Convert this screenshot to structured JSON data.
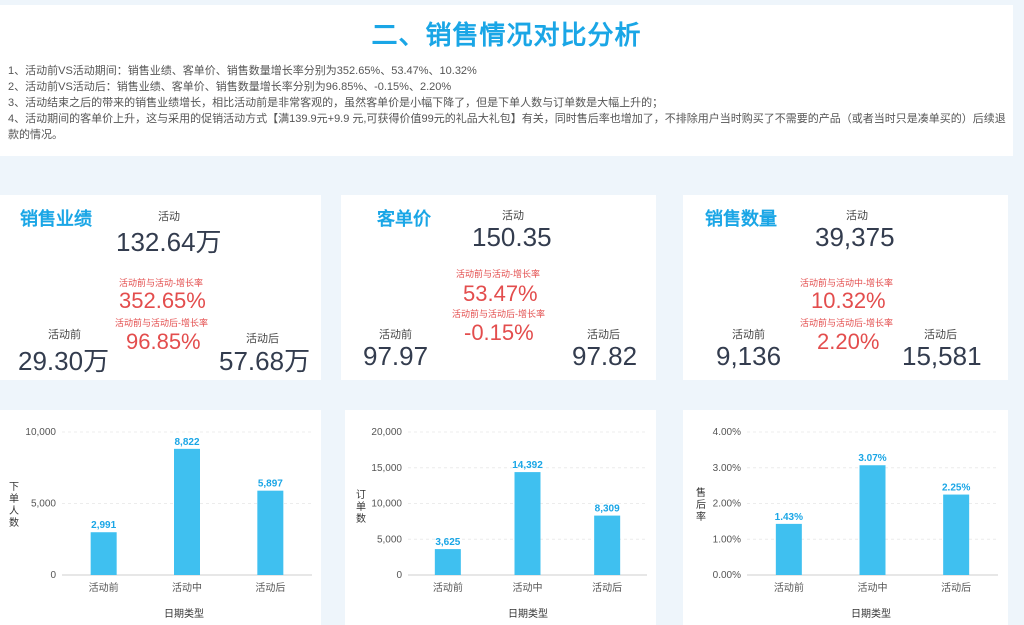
{
  "header": {
    "title": "二、销售情况对比分析",
    "notes": [
      "1、活动前VS活动期间：销售业绩、客单价、销售数量增长率分别为352.65%、53.47%、10.32%",
      "2、活动前VS活动后：销售业绩、客单价、销售数量增长率分别为96.85%、-0.15%、2.20%",
      "3、活动结束之后的带来的销售业绩增长，相比活动前是非常客观的，虽然客单价是小幅下降了，但是下单人数与订单数是大幅上升的；",
      "4、活动期间的客单价上升，这与采用的促销活动方式【满139.9元+9.9 元,可获得价值99元的礼品大礼包】有关，同时售后率也增加了，不排除用户当时购买了不需要的产品（或者当时只是凑单买的）后续退款的情况。"
    ]
  },
  "kpis": [
    {
      "title": "销售业绩",
      "during_label": "活动",
      "during_value": "132.64万",
      "rate1_label": "活动前与活动-增长率",
      "rate1_value": "352.65%",
      "rate2_label": "活动前与活动后-增长率",
      "rate2_value": "96.85%",
      "before_label": "活动前",
      "before_value": "29.30万",
      "after_label": "活动后",
      "after_value": "57.68万"
    },
    {
      "title": "客单价",
      "during_label": "活动",
      "during_value": "150.35",
      "rate1_label": "活动前与活动-增长率",
      "rate1_value": "53.47%",
      "rate2_label": "活动前与活动后-增长率",
      "rate2_value": "-0.15%",
      "before_label": "活动前",
      "before_value": "97.97",
      "after_label": "活动后",
      "after_value": "97.82"
    },
    {
      "title": "销售数量",
      "during_label": "活动",
      "during_value": "39,375",
      "rate1_label": "活动前与活动中-增长率",
      "rate1_value": "10.32%",
      "rate2_label": "活动前与活动后-增长率",
      "rate2_value": "2.20%",
      "before_label": "活动前",
      "before_value": "9,136",
      "after_label": "活动后",
      "after_value": "15,581"
    }
  ],
  "colors": {
    "accent": "#1aa6e6",
    "bar": "#3fc0f0",
    "rate": "#e34d4d"
  },
  "chart_data": [
    {
      "type": "bar",
      "categories": [
        "活动前",
        "活动中",
        "活动后"
      ],
      "values": [
        2991,
        8822,
        5897
      ],
      "value_labels": [
        "2,991",
        "8,822",
        "5,897"
      ],
      "ylim": [
        0,
        10000
      ],
      "yticks": [
        0,
        5000,
        10000
      ],
      "ytick_labels": [
        "0",
        "5,000",
        "10,000"
      ],
      "xlabel": "日期类型",
      "ylabel": "下单人数",
      "grid": true
    },
    {
      "type": "bar",
      "categories": [
        "活动前",
        "活动中",
        "活动后"
      ],
      "values": [
        3625,
        14392,
        8309
      ],
      "value_labels": [
        "3,625",
        "14,392",
        "8,309"
      ],
      "ylim": [
        0,
        20000
      ],
      "yticks": [
        0,
        5000,
        10000,
        15000,
        20000
      ],
      "ytick_labels": [
        "0",
        "5,000",
        "10,000",
        "15,000",
        "20,000"
      ],
      "xlabel": "日期类型",
      "ylabel": "订单数",
      "grid": true
    },
    {
      "type": "bar",
      "categories": [
        "活动前",
        "活动中",
        "活动后"
      ],
      "values": [
        1.43,
        3.07,
        2.25
      ],
      "value_labels": [
        "1.43%",
        "3.07%",
        "2.25%"
      ],
      "ylim": [
        0,
        4
      ],
      "yticks": [
        0,
        1,
        2,
        3,
        4
      ],
      "ytick_labels": [
        "0.00%",
        "1.00%",
        "2.00%",
        "3.00%",
        "4.00%"
      ],
      "xlabel": "日期类型",
      "ylabel": "售后率",
      "grid": true
    }
  ]
}
